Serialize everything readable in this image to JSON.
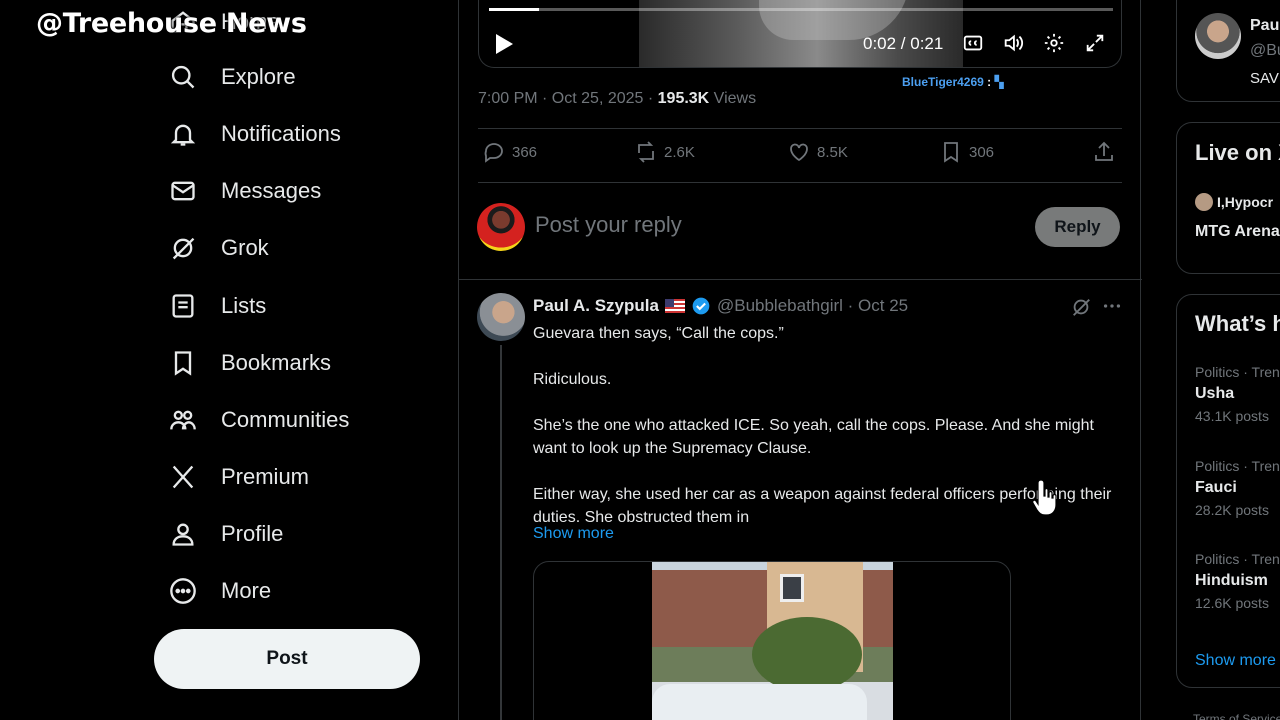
{
  "watermark": "@Treehouse News",
  "nav": {
    "items": [
      {
        "label": "Home",
        "icon": "home-icon"
      },
      {
        "label": "Explore",
        "icon": "search-icon"
      },
      {
        "label": "Notifications",
        "icon": "bell-icon"
      },
      {
        "label": "Messages",
        "icon": "mail-icon"
      },
      {
        "label": "Grok",
        "icon": "grok-icon"
      },
      {
        "label": "Lists",
        "icon": "list-icon"
      },
      {
        "label": "Bookmarks",
        "icon": "bookmark-icon"
      },
      {
        "label": "Communities",
        "icon": "communities-icon"
      },
      {
        "label": "Premium",
        "icon": "x-logo-icon"
      },
      {
        "label": "Profile",
        "icon": "person-icon"
      },
      {
        "label": "More",
        "icon": "more-circle-icon"
      }
    ],
    "post_label": "Post"
  },
  "video": {
    "time": "0:02 / 0:21",
    "progress": 0.08,
    "overlay_user": "BlueTiger4269",
    "overlay_sep": ":"
  },
  "post_meta": {
    "datetime": "7:00 PM · Oct 25, 2025 · ",
    "views_count": "195.3K",
    "views_label": " Views"
  },
  "actions": {
    "replies": "366",
    "reposts": "2.6K",
    "likes": "8.5K",
    "bookmarks": "306"
  },
  "reply_box": {
    "placeholder": "Post your reply",
    "button": "Reply"
  },
  "tweet": {
    "name": "Paul A. Szypula",
    "handle": "@Bubblebathgirl · Oct 25",
    "paragraphs": [
      "Guevara then says, “Call the cops.”",
      "Ridiculous.",
      "She’s the one who attacked ICE. So yeah, call the cops. Please. And she might want to look up the Supremacy Clause.",
      "Either way, she used her car as a weapon against federal officers performing their duties. She obstructed them in"
    ],
    "show_more": "Show more"
  },
  "sidebar": {
    "who_to_follow": {
      "name": "Pau",
      "handle": "@Bu",
      "sub": "SAV"
    },
    "live_title": "Live on X",
    "live_host": "I,Hypocr",
    "live_stream": "MTG Arena",
    "trends_title": "What’s h",
    "trends": [
      {
        "context": "Politics · Trending",
        "topic": "Usha",
        "count": "43.1K posts"
      },
      {
        "context": "Politics · Trending",
        "topic": "Fauci",
        "count": "28.2K posts"
      },
      {
        "context": "Politics · Trending",
        "topic": "Hinduism",
        "count": "12.6K posts"
      }
    ],
    "show_more": "Show more",
    "terms": "Terms of Service"
  }
}
